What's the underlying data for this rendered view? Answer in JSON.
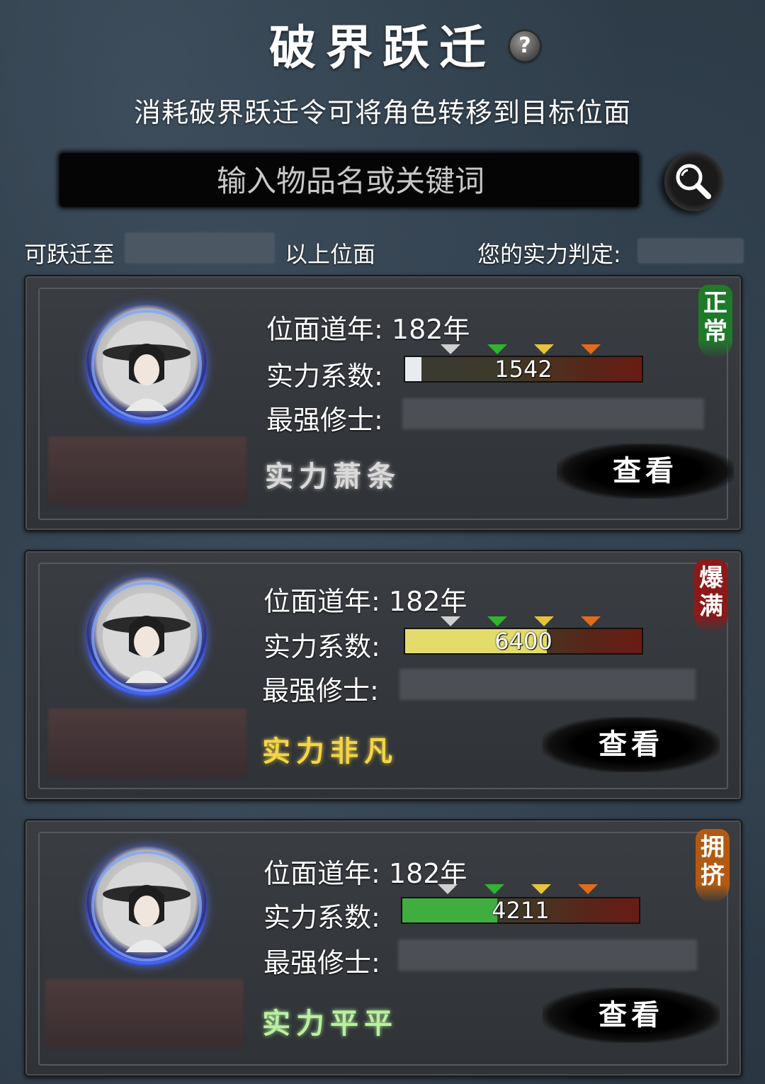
{
  "header": {
    "title": "破界跃迁",
    "help_icon": "?",
    "subtitle": "消耗破界跃迁令可将角色转移到目标位面"
  },
  "search": {
    "placeholder": "输入物品名或关键词"
  },
  "info": {
    "transfer_prefix": "可跃迁至",
    "transfer_suffix": "以上位面",
    "strength_label": "您的实力判定:"
  },
  "cards": [
    {
      "year_label": "位面道年:",
      "year_value": "182年",
      "strength_label": "实力系数:",
      "strength_value": "1542",
      "strength_fill": 0.07,
      "fill_color": "#e8ecee",
      "strongest_label": "最强修士:",
      "tier": "实力萧条",
      "tier_color": "#d9d9d9",
      "view_label": "查看",
      "status": "正常",
      "status_color": "#1f7a2a"
    },
    {
      "year_label": "位面道年:",
      "year_value": "182年",
      "strength_label": "实力系数:",
      "strength_value": "6400",
      "strength_fill": 0.6,
      "fill_color": "#e3dc6a",
      "strongest_label": "最强修士:",
      "tier": "实力非凡",
      "tier_color": "#f3d54a",
      "view_label": "查看",
      "status": "爆满",
      "status_color": "#8c1a1a"
    },
    {
      "year_label": "位面道年:",
      "year_value": "182年",
      "strength_label": "实力系数:",
      "strength_value": "4211",
      "strength_fill": 0.4,
      "fill_color": "#3fae3f",
      "strongest_label": "最强修士:",
      "tier": "实力平平",
      "tier_color": "#b8f0a0",
      "view_label": "查看",
      "status": "拥挤",
      "status_color": "#b35a12"
    }
  ],
  "marker_colors": [
    "#d0d0d0",
    "#2fb52f",
    "#e6c43a",
    "#e66a1a"
  ]
}
